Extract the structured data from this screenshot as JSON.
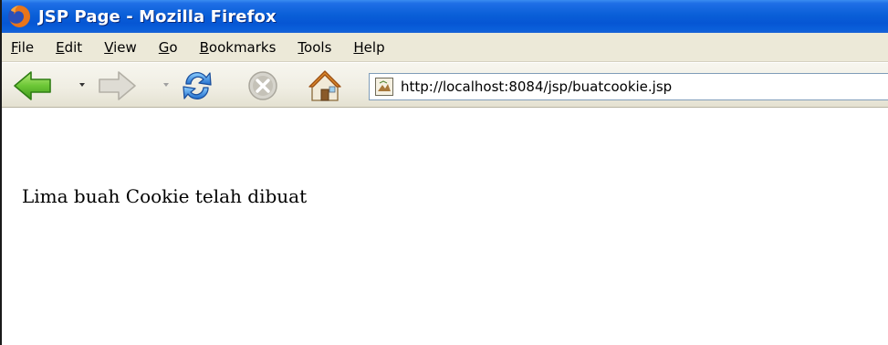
{
  "window": {
    "title": "JSP Page - Mozilla Firefox"
  },
  "menu": {
    "items": [
      {
        "mnemonic": "F",
        "rest": "ile"
      },
      {
        "mnemonic": "E",
        "rest": "dit"
      },
      {
        "mnemonic": "V",
        "rest": "iew"
      },
      {
        "mnemonic": "G",
        "rest": "o"
      },
      {
        "mnemonic": "B",
        "rest": "ookmarks"
      },
      {
        "mnemonic": "T",
        "rest": "ools"
      },
      {
        "mnemonic": "H",
        "rest": "elp"
      }
    ]
  },
  "toolbar": {
    "icons": [
      "back-arrow-icon",
      "forward-arrow-icon",
      "reload-icon",
      "stop-icon",
      "home-icon",
      "page-icon"
    ]
  },
  "address": {
    "url": "http://localhost:8084/jsp/buatcookie.jsp"
  },
  "page": {
    "message": "Lima buah Cookie telah dibuat"
  },
  "colors": {
    "titlebar": "#0a5fd8",
    "chrome": "#ece9d8",
    "back_arrow": "#5fbf2a",
    "reload": "#2d7fd4"
  }
}
